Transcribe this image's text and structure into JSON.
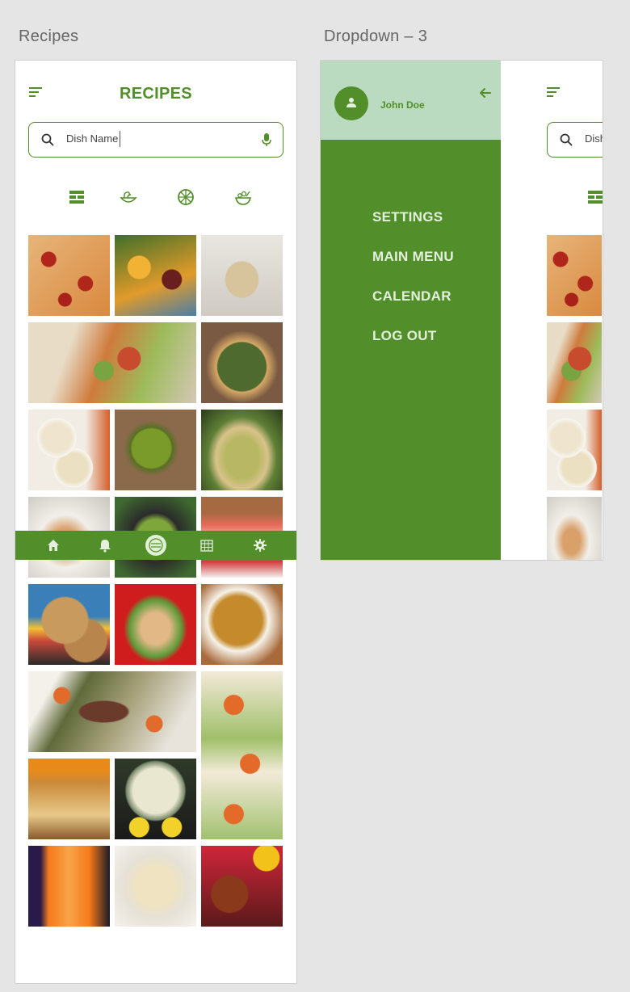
{
  "artboards": {
    "recipes_label": "Recipes",
    "dropdown_label": "Dropdown – 3"
  },
  "recipes": {
    "title": "RECIPES",
    "search": {
      "placeholder": "Dish Name"
    },
    "categories": [
      "grid-view-icon",
      "noodle-bowl-icon",
      "pizza-icon",
      "salad-bowl-icon"
    ],
    "tiles": [
      "pepperoni-pizza",
      "fruit-salad",
      "bruschetta",
      "bread-salad",
      "spinach-tart",
      "chicken-soup",
      "green-soup",
      "quiche-slice",
      "plated-dish",
      "guacamole",
      "cheesecake",
      "cookies",
      "chicken-cutlets",
      "lentil-soup",
      "steak-and-shrimp",
      "shrimp-tacos",
      "banana-bread",
      "lemonade",
      "carrot-juice",
      "fettuccine",
      "iced-tea"
    ],
    "bottom_nav": [
      "home-icon",
      "notification-bell-icon",
      "center-menu-icon",
      "calendar-icon",
      "settings-icon"
    ]
  },
  "dropdown": {
    "user_name": "John Doe",
    "menu": [
      "SETTINGS",
      "MAIN MENU",
      "CALENDAR",
      "LOG OUT"
    ],
    "peek_search_placeholder": "Dish"
  },
  "colors": {
    "primary": "#528e2a",
    "drawer_header": "#badbc0",
    "menu_text": "#e3f0dc"
  }
}
